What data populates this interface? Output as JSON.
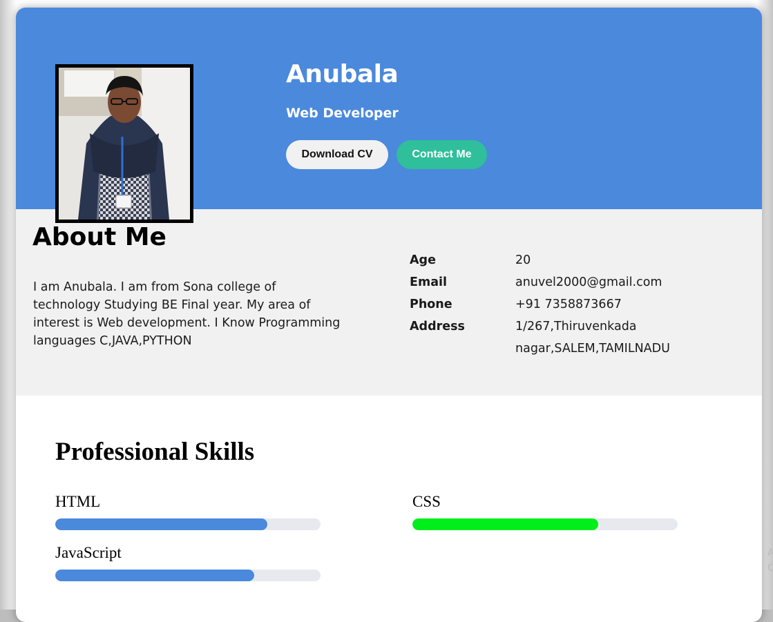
{
  "profile": {
    "name": "Anubala",
    "role": "Web Developer",
    "photo_icon": "profile-photo"
  },
  "buttons": {
    "download_cv": "Download CV",
    "contact_me": "Contact Me"
  },
  "about": {
    "title": "About Me",
    "text": "I am Anubala. I am from Sona college of technology Studying BE Final year. My area of interest is Web development. I Know Programming languages C,JAVA,PYTHON",
    "details": [
      {
        "label": "Age",
        "value": "20"
      },
      {
        "label": "Email",
        "value": "anuvel2000@gmail.com"
      },
      {
        "label": "Phone",
        "value": "+91 7358873667"
      },
      {
        "label": "Address",
        "value": "1/267,Thiruvenkada nagar,SALEM,TAMILNADU"
      }
    ]
  },
  "skills": {
    "title": "Professional Skills",
    "items": [
      {
        "name": "HTML",
        "percent": 80,
        "color": "#4a89dc"
      },
      {
        "name": "CSS",
        "percent": 70,
        "color": "#00ee1a"
      },
      {
        "name": "JavaScript",
        "percent": 75,
        "color": "#4a89dc"
      }
    ]
  },
  "colors": {
    "hero": "#4a89dc",
    "contact_button": "#2fbf9b",
    "about_bg": "#f1f1f2",
    "track": "#e8e9ee"
  }
}
